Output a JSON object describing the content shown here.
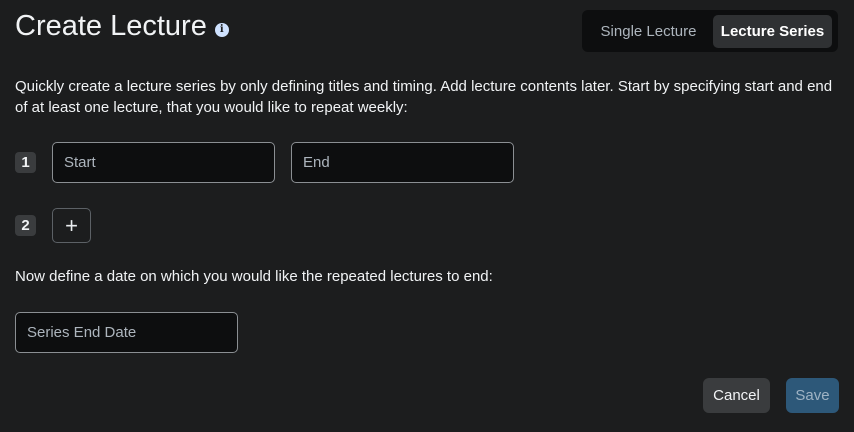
{
  "header": {
    "title": "Create Lecture",
    "info_icon": "info-icon",
    "modes": {
      "single": "Single Lecture",
      "series": "Lecture Series",
      "selected": "series"
    }
  },
  "description": "Quickly create a lecture series by only defining titles and timing. Add lecture contents later. Start by specifying start and end of at least one lecture, that you would like to repeat weekly:",
  "lectures": [
    {
      "number": "1",
      "start_placeholder": "Start",
      "end_placeholder": "End"
    }
  ],
  "next_row": {
    "number": "2",
    "add_icon": "plus-icon",
    "add_symbol": "+"
  },
  "end_prompt": "Now define a date on which you would like the repeated lectures to end:",
  "series_end_placeholder": "Series End Date",
  "footer": {
    "cancel_label": "Cancel",
    "save_label": "Save"
  },
  "colors": {
    "background": "#1c1d1e",
    "input_bg": "#0d0e0f",
    "save_bg": "#2d5879"
  }
}
